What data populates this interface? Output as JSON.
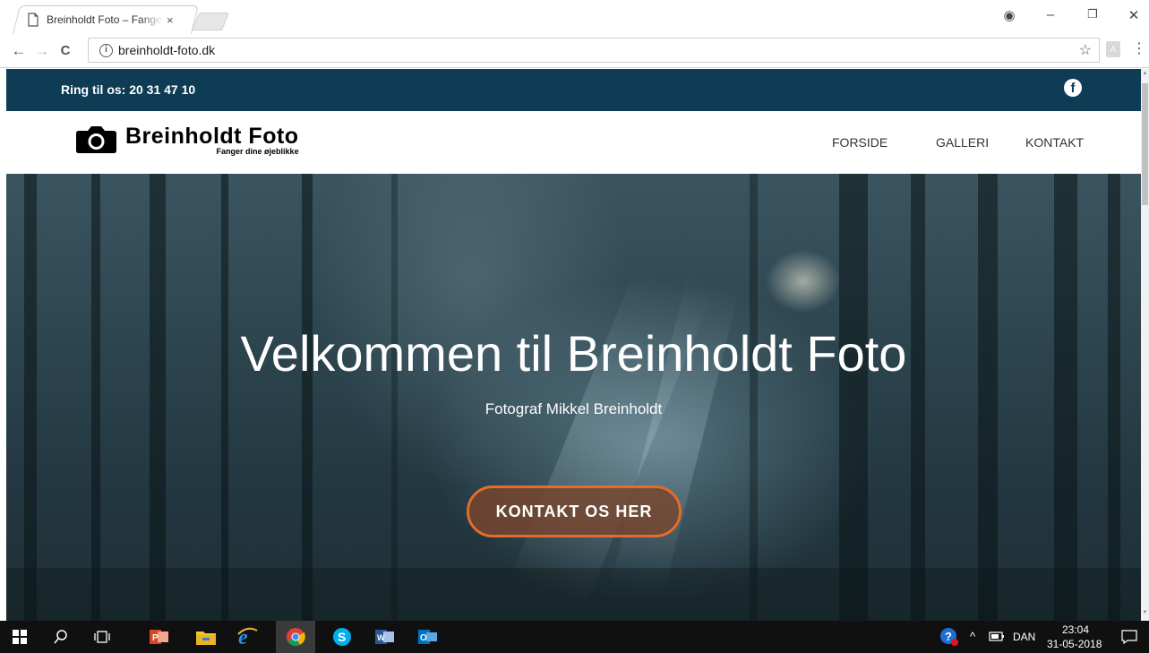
{
  "browser": {
    "tab_title": "Breinholdt Foto – Fanger dine øjeblikke",
    "tab_close": "×",
    "url": "breinholdt-foto.dk",
    "info_glyph": "i",
    "star_glyph": "☆",
    "ext_glyph": "A",
    "back_glyph": "←",
    "forward_glyph": "→",
    "reload_glyph": "C",
    "menu_glyph": "⋮",
    "win_minimize": "–",
    "win_restore": "❐",
    "win_close": "✕",
    "profile_glyph": "◉"
  },
  "site": {
    "topbar": {
      "phone": "Ring til os: 20 31 47 10",
      "fb_glyph": "f"
    },
    "logo": {
      "title": "Breinholdt Foto",
      "tagline": "Fanger dine øjeblikke"
    },
    "menu": [
      "FORSIDE",
      "GALLERI",
      "KONTAKT"
    ],
    "hero": {
      "title": "Velkommen til Breinholdt Foto",
      "subtitle": "Fotograf Mikkel Breinholdt",
      "cta": "KONTAKT OS HER"
    }
  },
  "taskbar": {
    "tray": {
      "language": "DAN",
      "time": "23:04",
      "date": "31-05-2018",
      "chevron": "^"
    }
  },
  "colors": {
    "topbar": "#0e3c55",
    "cta_border": "#e46c2b",
    "taskbar": "#101010"
  }
}
